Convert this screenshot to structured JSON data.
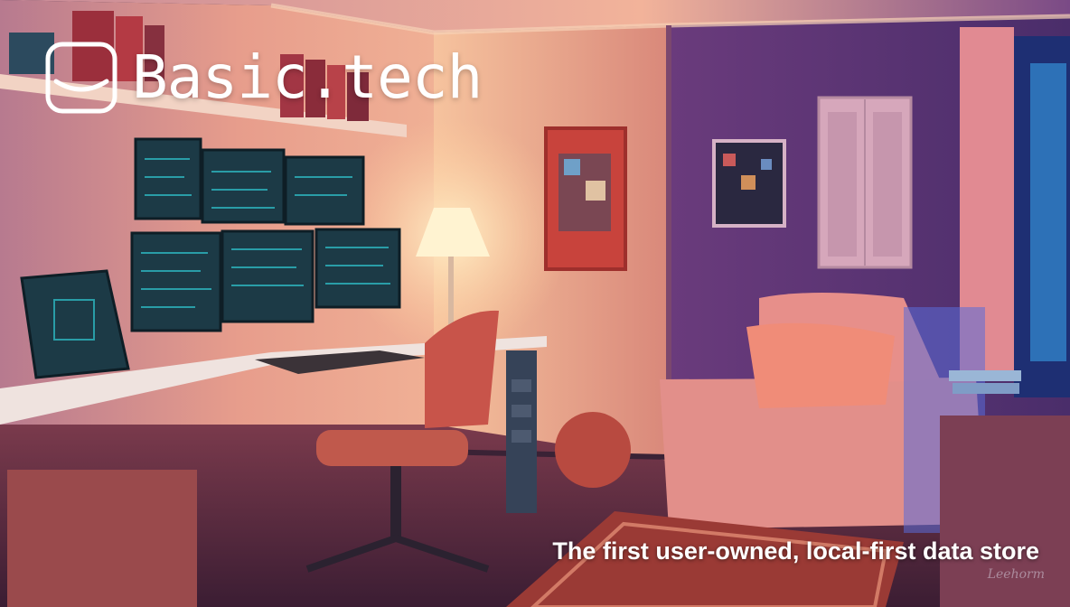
{
  "brand": {
    "name": "Basic.tech",
    "tagline": "The first user-owned, local-first data store",
    "logo_icon": "smile-square-icon",
    "text_color": "#ffffff"
  },
  "artwork": {
    "signature": "Leehorm",
    "palette": {
      "warm_wall": "#e39a85",
      "violet_wall": "#5a3574",
      "lamp_glow": "#ffe3b0",
      "screen_glow": "#2fc7d0",
      "armchair": "#e58d87",
      "rug": "#9a3a35"
    }
  }
}
